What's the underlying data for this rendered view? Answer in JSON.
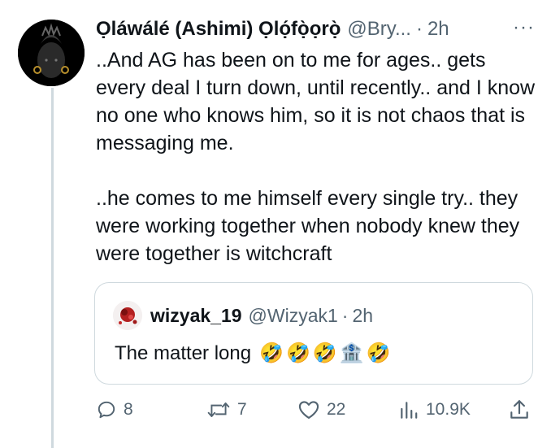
{
  "author": {
    "display_name": "Ọláwálé (Ashimi) Ọlọ́fọ̀ọrọ̀",
    "handle": "@Bry...",
    "time": "2h",
    "separator": "·",
    "more_label": "···"
  },
  "tweet": {
    "paragraphs": [
      "..And AG has been on to me for ages.. gets every deal I turn down, until recently.. and I know no one who knows him, so it is not chaos that is messaging me.",
      "..he comes to me himself every single try.. they were working together when nobody knew they were together is witchcraft"
    ]
  },
  "quote": {
    "display_name": "wizyak_19",
    "handle": "@Wizyak1",
    "separator": "·",
    "time": "2h",
    "text": "The matter long",
    "emojis": [
      "🤣",
      "🤣",
      "🤣",
      "🏦",
      "🤣"
    ]
  },
  "actions": {
    "replies": "8",
    "retweets": "7",
    "likes": "22",
    "views": "10.9K"
  },
  "colors": {
    "text": "#0f1419",
    "secondary": "#536471",
    "border": "#cfd9de"
  }
}
